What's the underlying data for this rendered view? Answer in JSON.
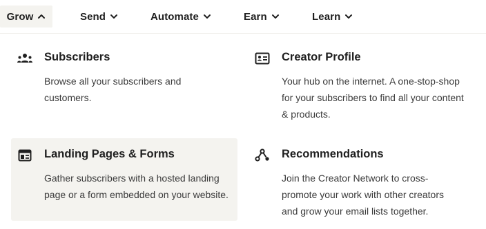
{
  "nav": {
    "items": [
      {
        "label": "Grow",
        "active": true,
        "chevron": "chevron-up-icon"
      },
      {
        "label": "Send",
        "active": false,
        "chevron": "chevron-down-icon"
      },
      {
        "label": "Automate",
        "active": false,
        "chevron": "chevron-down-icon"
      },
      {
        "label": "Earn",
        "active": false,
        "chevron": "chevron-down-icon"
      },
      {
        "label": "Learn",
        "active": false,
        "chevron": "chevron-down-icon"
      }
    ]
  },
  "menu": {
    "items": [
      {
        "title": "Subscribers",
        "description": "Browse all your subscribers and customers.",
        "icon": "users-icon",
        "highlighted": false
      },
      {
        "title": "Creator Profile",
        "description": "Your hub on the internet. A one-stop-shop for your subscribers to find all your content & products.",
        "icon": "profile-card-icon",
        "highlighted": false
      },
      {
        "title": "Landing Pages & Forms",
        "description": "Gather subscribers with a hosted landing page or a form embedded on your website.",
        "icon": "landing-page-icon",
        "highlighted": true
      },
      {
        "title": "Recommendations",
        "description": "Join the Creator Network to cross-promote your work with other creators and grow your email lists together.",
        "icon": "recommendations-network-icon",
        "highlighted": false
      }
    ]
  },
  "colors": {
    "text": "#1f1f1f",
    "muted": "#3a3a3a",
    "highlight": "#f4f3ef"
  }
}
